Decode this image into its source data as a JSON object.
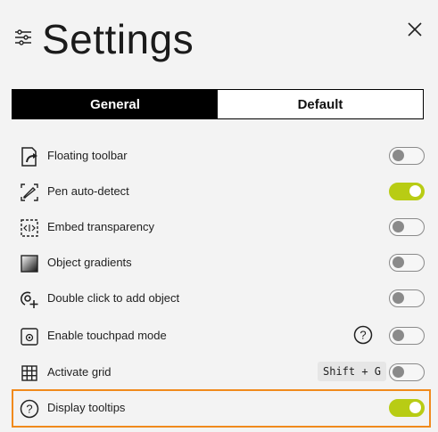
{
  "header": {
    "title": "Settings",
    "settings_icon": "sliders-icon",
    "close_icon": "close-icon"
  },
  "tabs": [
    {
      "label": "General",
      "active": true
    },
    {
      "label": "Default",
      "active": false
    }
  ],
  "settings": [
    {
      "label": "Floating toolbar",
      "icon": "floating-toolbar-icon",
      "enabled": false
    },
    {
      "label": "Pen auto-detect",
      "icon": "pen-detect-icon",
      "enabled": true
    },
    {
      "label": "Embed transparency",
      "icon": "embed-transparency-icon",
      "enabled": false
    },
    {
      "label": "Object gradients",
      "icon": "gradient-icon",
      "enabled": false
    },
    {
      "label": "Double click to add object",
      "icon": "add-object-icon",
      "enabled": false
    },
    {
      "label": "Enable touchpad mode",
      "icon": "touchpad-icon",
      "enabled": false,
      "help_icon": "help-icon"
    },
    {
      "label": "Activate grid",
      "icon": "grid-icon",
      "enabled": false,
      "shortcut": "Shift + G"
    },
    {
      "label": "Display tooltips",
      "icon": "help-circle-icon",
      "enabled": true,
      "highlighted": true
    }
  ],
  "colors": {
    "accent": "#b8cc14",
    "highlight": "#f08a1c",
    "toggle_off": "#8a8a8a",
    "background": "#f3f3f3"
  }
}
